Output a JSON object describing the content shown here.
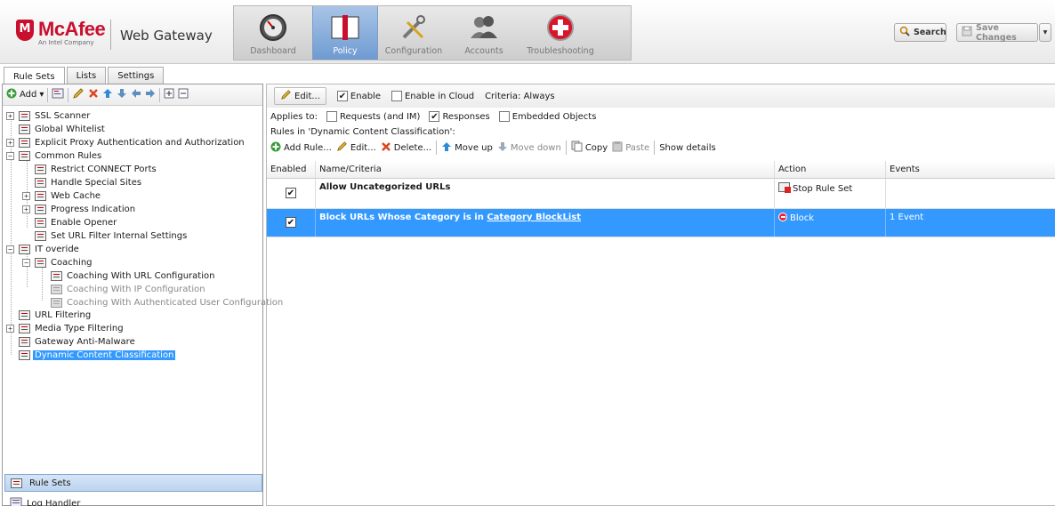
{
  "header": {
    "brand": "McAfee",
    "brand_tagline": "An Intel Company",
    "product": "Web Gateway",
    "nav": [
      {
        "label": "Dashboard",
        "icon": "gauge-icon"
      },
      {
        "label": "Policy",
        "icon": "book-icon",
        "active": true
      },
      {
        "label": "Configuration",
        "icon": "tools-icon"
      },
      {
        "label": "Accounts",
        "icon": "users-icon"
      },
      {
        "label": "Troubleshooting",
        "icon": "red-cross-icon"
      }
    ],
    "search_label": "Search",
    "save_label": "Save Changes"
  },
  "left": {
    "tabs": [
      "Rule Sets",
      "Lists",
      "Settings"
    ],
    "add_label": "Add",
    "tree": [
      {
        "label": "SSL Scanner"
      },
      {
        "label": "Global Whitelist"
      },
      {
        "label": "Explicit Proxy Authentication and Authorization"
      },
      {
        "label": "Common Rules"
      },
      {
        "label": "Restrict CONNECT Ports"
      },
      {
        "label": "Handle Special Sites"
      },
      {
        "label": "Web Cache"
      },
      {
        "label": "Progress Indication"
      },
      {
        "label": "Enable Opener"
      },
      {
        "label": "Set URL Filter Internal Settings"
      },
      {
        "label": "IT overide"
      },
      {
        "label": "Coaching"
      },
      {
        "label": "Coaching With URL Configuration"
      },
      {
        "label": "Coaching With IP Configuration"
      },
      {
        "label": "Coaching With Authenticated User Configuration"
      },
      {
        "label": "URL Filtering"
      },
      {
        "label": "Media Type Filtering"
      },
      {
        "label": "Gateway Anti-Malware"
      },
      {
        "label": "Dynamic Content Classification"
      }
    ],
    "bottom": [
      "Rule Sets",
      "Log Handler"
    ]
  },
  "right": {
    "edit_label": "Edit...",
    "enable_label": "Enable",
    "enable_cloud_label": "Enable in Cloud",
    "criteria_label": "Criteria: Always",
    "applies_label": "Applies to:",
    "applies": [
      {
        "label": "Requests (and IM)",
        "checked": false
      },
      {
        "label": "Responses",
        "checked": true
      },
      {
        "label": "Embedded Objects",
        "checked": false
      }
    ],
    "rules_in": "Rules in 'Dynamic Content Classification':",
    "rules_toolbar": {
      "add": "Add Rule...",
      "edit": "Edit...",
      "delete": "Delete...",
      "move_up": "Move up",
      "move_down": "Move down",
      "copy": "Copy",
      "paste": "Paste",
      "details": "Show details"
    },
    "columns": [
      "Enabled",
      "Name/Criteria",
      "Action",
      "Events"
    ],
    "rows": [
      {
        "name": "Allow Uncategorized URLs",
        "name_link": "",
        "action": "Stop Rule Set",
        "events": "",
        "enabled": true
      },
      {
        "name": "Block URLs Whose Category is in ",
        "name_link": "Category BlockList",
        "action": "Block",
        "events": "1 Event",
        "enabled": true
      }
    ]
  },
  "colors": {
    "brand_red": "#c8102e",
    "selection_blue": "#3399ff",
    "nav_active": "#6f9bd2"
  }
}
